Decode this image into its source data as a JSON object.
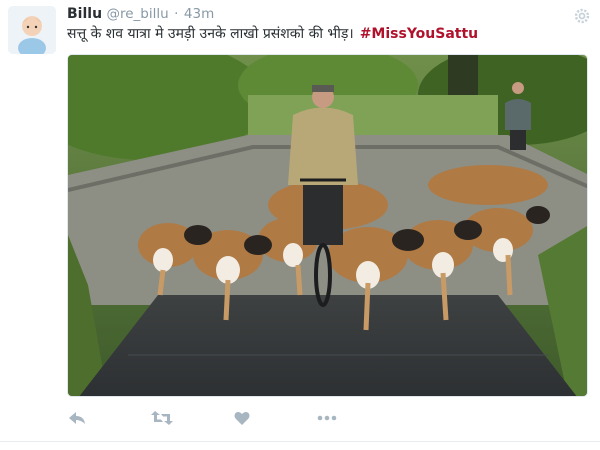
{
  "user": {
    "name": "Billu",
    "handle": "@re_billu",
    "separator": "·",
    "time": "43m"
  },
  "tweet": {
    "text": "सत्तू के शव यात्रा मे उमड़ी उनके लाखो प्रसंशको की भीड़।",
    "hashtag": "#MissYouSattu"
  },
  "icons": {
    "avatar": "avatar-baby-illustration",
    "gear": "gear-icon",
    "reply": "reply-icon",
    "retweet": "retweet-icon",
    "like": "heart-icon",
    "more": "more-dots-icon"
  },
  "colors": {
    "name": "#292f33",
    "meta": "#8899a6",
    "hashtag": "#b0122c",
    "icon": "#a8b6c2"
  }
}
